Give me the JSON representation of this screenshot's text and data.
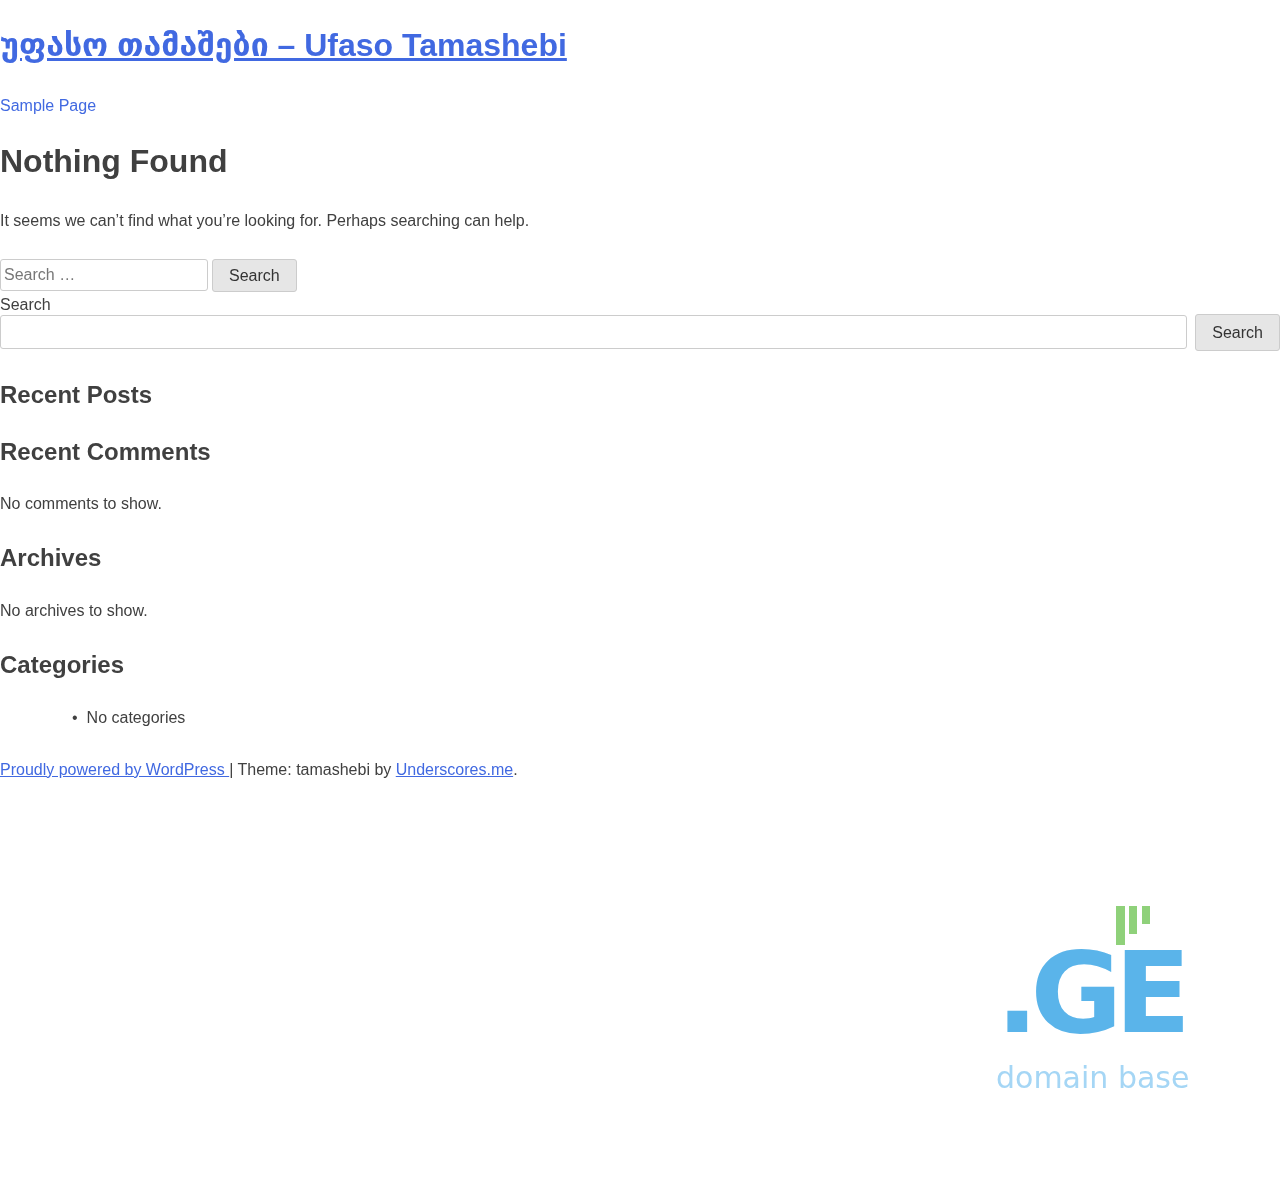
{
  "site_title": "უფასო თამაშები – Ufaso Tamashebi",
  "menu": [
    {
      "label": "Sample Page"
    }
  ],
  "page_title": "Nothing Found",
  "message": "It seems we can’t find what you’re looking for. Perhaps searching can help.",
  "search_form": {
    "placeholder": "Search …",
    "button": "Search"
  },
  "search_widget": {
    "label": "Search",
    "button": "Search"
  },
  "widgets": [
    {
      "title": "Recent Posts"
    },
    {
      "title": "Recent Comments",
      "text": "No comments to show."
    },
    {
      "title": "Archives",
      "text": "No archives to show."
    },
    {
      "title": "Categories",
      "items": [
        {
          "marker": "•",
          "label": "No categories"
        }
      ]
    }
  ],
  "footer": {
    "powered_link": "Proudly powered by WordPress ",
    "theme_text": "| Theme: tamashebi by ",
    "theme_link": "Underscores.me",
    "end": "."
  },
  "logo": {
    "mark": ".GE",
    "caption": "domain base"
  }
}
